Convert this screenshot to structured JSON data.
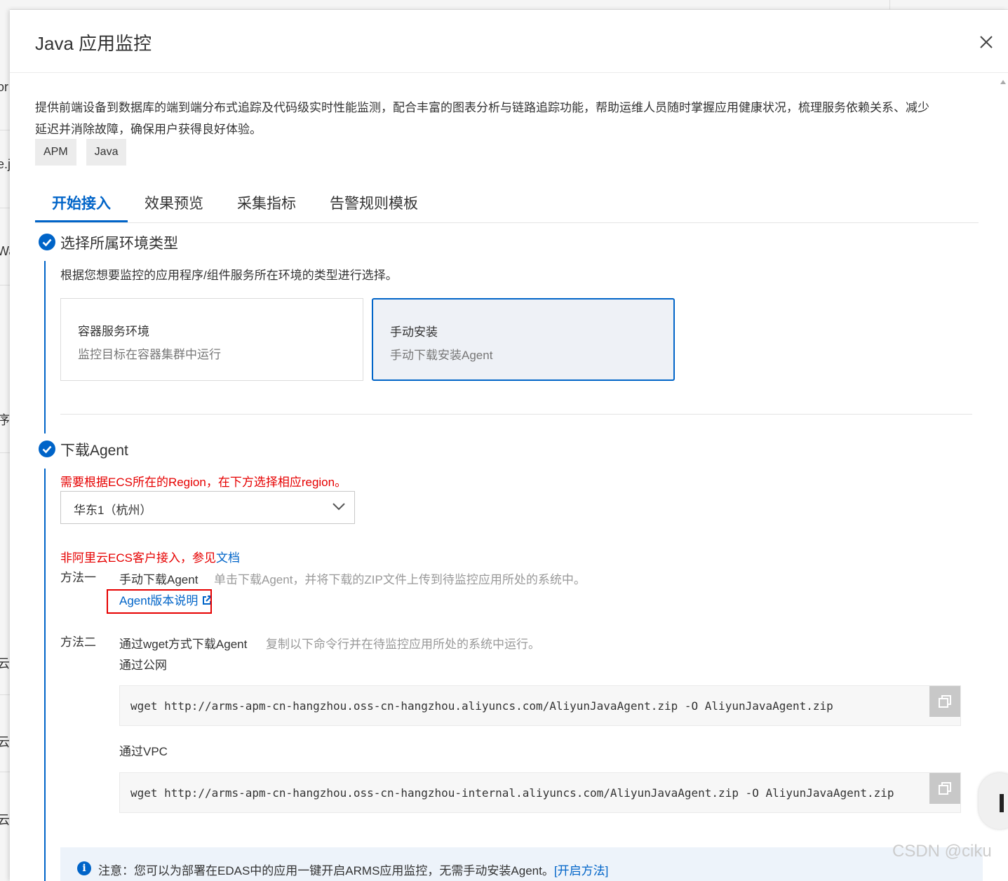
{
  "background": {
    "fragments": [
      "or",
      "e.j",
      "Wa",
      "序",
      "云",
      "云",
      "云"
    ]
  },
  "drawer": {
    "title": "Java 应用监控",
    "description": "提供前端设备到数据库的端到端分布式追踪及代码级实时性能监测，配合丰富的图表分析与链路追踪功能，帮助运维人员随时掌握应用健康状况，梳理服务依赖关系、减少延迟并消除故障，确保用户获得良好体验。",
    "tags": [
      "APM",
      "Java"
    ]
  },
  "tabs": [
    {
      "label": "开始接入",
      "active": true
    },
    {
      "label": "效果预览",
      "active": false
    },
    {
      "label": "采集指标",
      "active": false
    },
    {
      "label": "告警规则模板",
      "active": false
    }
  ],
  "step1": {
    "title": "选择所属环境类型",
    "hint": "根据您想要监控的应用程序/组件服务所在环境的类型进行选择。",
    "cards": [
      {
        "title": "容器服务环境",
        "subtitle": "监控目标在容器集群中运行",
        "selected": false
      },
      {
        "title": "手动安装",
        "subtitle": "手动下载安装Agent",
        "selected": true
      }
    ]
  },
  "step2": {
    "title": "下载Agent",
    "region_note": "需要根据ECS所在的Region，在下方选择相应region。",
    "region_value": "华东1（杭州）",
    "non_aliyun_note": "非阿里云ECS客户接入，参见",
    "doc_link": "文档",
    "method1": {
      "label": "方法一",
      "name": "手动下载Agent",
      "desc": "单击下载Agent，并将下载的ZIP文件上传到待监控应用所处的系统中。",
      "link": "Agent版本说明"
    },
    "method2": {
      "label": "方法二",
      "name": "通过wget方式下载Agent",
      "desc": "复制以下命令行并在待监控应用所处的系统中运行。",
      "public_label": "通过公网",
      "public_cmd": "wget http://arms-apm-cn-hangzhou.oss-cn-hangzhou.aliyuncs.com/AliyunJavaAgent.zip -O AliyunJavaAgent.zip",
      "vpc_label": "通过VPC",
      "vpc_cmd": "wget http://arms-apm-cn-hangzhou.oss-cn-hangzhou-internal.aliyuncs.com/AliyunJavaAgent.zip -O AliyunJavaAgent.zip"
    }
  },
  "notice": {
    "text": "注意：您可以为部署在EDAS中的应用一键开启ARMS应用监控，无需手动安装Agent。",
    "link": "[开启方法]"
  },
  "watermark": "CSDN @ciku",
  "colors": {
    "accent": "#0064c8",
    "warning": "#e60000"
  }
}
